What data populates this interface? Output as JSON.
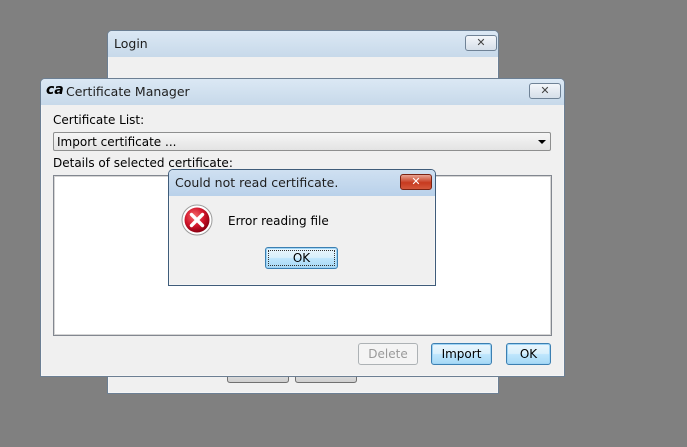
{
  "login_window": {
    "title": "Login",
    "close_glyph": "✕"
  },
  "cert_manager": {
    "logo_text": "ca",
    "title": "Certificate Manager",
    "close_glyph": "✕",
    "certificate_list_label": "Certificate List:",
    "certificate_select_value": "Import certificate ...",
    "details_label": "Details of selected certificate:",
    "delete_label": "Delete",
    "import_label": "Import",
    "ok_label": "OK"
  },
  "error_dialog": {
    "title": "Could not read certificate.",
    "close_glyph": "✕",
    "message": "Error reading file",
    "ok_label": "OK",
    "icon": "error-x-icon"
  },
  "colors": {
    "desktop": "#808080",
    "error_red": "#c8102e",
    "titlebar": "#c7d9ea"
  }
}
